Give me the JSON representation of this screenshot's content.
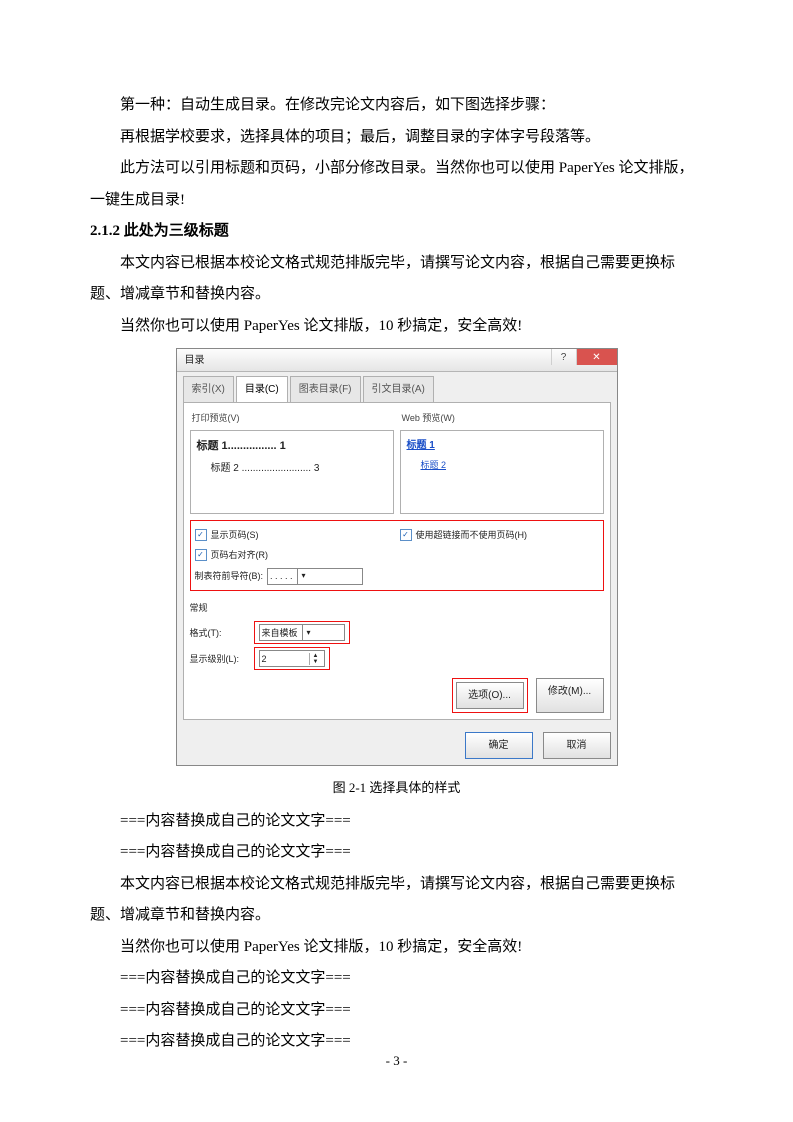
{
  "paragraphs": {
    "p1": "第一种：自动生成目录。在修改完论文内容后，如下图选择步骤：",
    "p2": "再根据学校要求，选择具体的项目；最后，调整目录的字体字号段落等。",
    "p3": "此方法可以引用标题和页码，小部分修改目录。当然你也可以使用 PaperYes 论文排版，一键生成目录!",
    "h212": "2.1.2  此处为三级标题",
    "p4": "本文内容已根据本校论文格式规范排版完毕，请撰写论文内容，根据自己需要更换标题、增减章节和替换内容。",
    "p5": "当然你也可以使用 PaperYes 论文排版，10 秒搞定，安全高效!",
    "caption": "图 2-1  选择具体的样式",
    "ph1": "===内容替换成自己的论文文字===",
    "ph2": "===内容替换成自己的论文文字===",
    "p6": "本文内容已根据本校论文格式规范排版完毕，请撰写论文内容，根据自己需要更换标题、增减章节和替换内容。",
    "p7": "当然你也可以使用 PaperYes 论文排版，10 秒搞定，安全高效!",
    "ph3": "===内容替换成自己的论文文字===",
    "ph4": "===内容替换成自己的论文文字===",
    "ph5": "===内容替换成自己的论文文字==="
  },
  "page_number": "- 3 -",
  "dialog": {
    "title": "目录",
    "tabs": {
      "t1": "索引(X)",
      "t2": "目录(C)",
      "t3": "图表目录(F)",
      "t4": "引文目录(A)"
    },
    "left_label": "打印预览(V)",
    "right_label": "Web 预览(W)",
    "preview_left": {
      "line1": "标题 1................ 1",
      "line2": "标题 2 ......................... 3"
    },
    "preview_right": {
      "link1": "标题 1",
      "link2": "标题 2"
    },
    "chk_show_page": "显示页码(S)",
    "chk_right_align": "页码右对齐(R)",
    "tab_leader_label": "制表符前导符(B):",
    "tab_leader_value": ". . . . .",
    "chk_hyperlink": "使用超链接而不使用页码(H)",
    "norm_heading": "常规",
    "format_label": "格式(T):",
    "format_value": "来自模板",
    "levels_label": "显示级别(L):",
    "levels_value": "2",
    "btn_options": "选项(O)...",
    "btn_modify": "修改(M)...",
    "btn_ok": "确定",
    "btn_cancel": "取消"
  }
}
